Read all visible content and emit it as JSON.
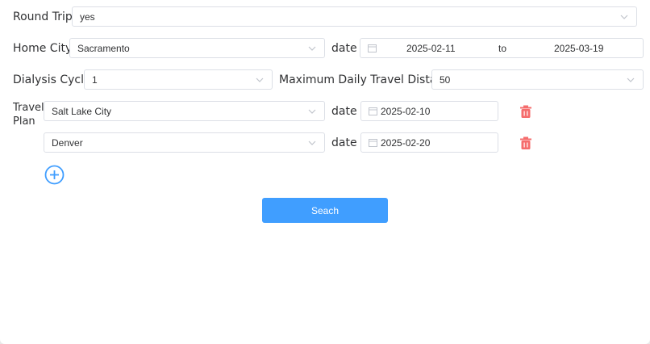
{
  "form": {
    "round_trip": {
      "label": "Round Trip",
      "value": "yes"
    },
    "home_city": {
      "label": "Home City",
      "value": "Sacramento",
      "date_label": "date",
      "start_date": "2025-02-11",
      "range_separator": "to",
      "end_date": "2025-03-19"
    },
    "dialysis_cycle": {
      "label": "Dialysis Cycle",
      "value": "1"
    },
    "max_distance": {
      "label": "Maximum Daily Travel Distance",
      "value": "50"
    },
    "travel_plan": {
      "label_line1": "Travel",
      "label_line2": "Plan",
      "date_label": "date",
      "stops": [
        {
          "city": "Salt Lake City",
          "date": "2025-02-10"
        },
        {
          "city": "Denver",
          "date": "2025-02-20"
        }
      ]
    },
    "search_label": "Seach"
  },
  "colors": {
    "primary": "#409eff",
    "danger": "#f56c6c",
    "border": "#dcdfe6"
  },
  "icons": {
    "dropdown": "chevron-down-icon",
    "calendar": "calendar-icon",
    "delete": "trash-icon",
    "add": "plus-circle-icon"
  }
}
